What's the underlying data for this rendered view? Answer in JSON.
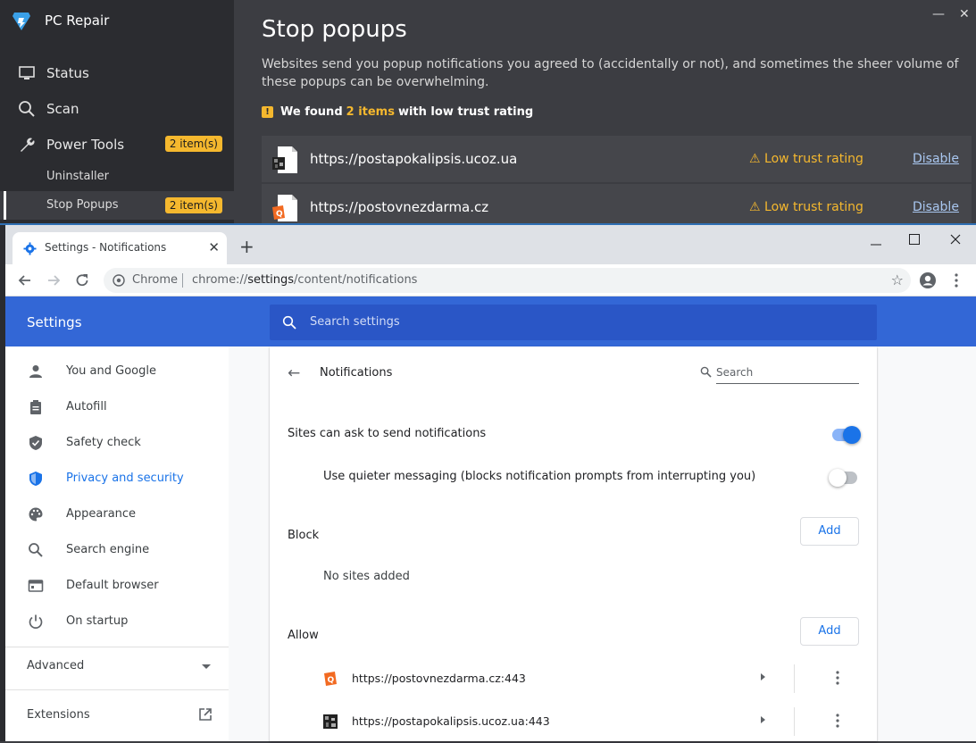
{
  "pcrepair": {
    "app_name": "PC Repair",
    "nav": [
      {
        "label": "Status",
        "icon": "monitor-icon"
      },
      {
        "label": "Scan",
        "icon": "magnifier-icon"
      },
      {
        "label": "Power Tools",
        "icon": "wrench-icon",
        "badge": "2 item(s)"
      }
    ],
    "subnav": [
      {
        "label": "Uninstaller"
      },
      {
        "label": "Stop Popups",
        "badge": "2 item(s)",
        "active": true
      }
    ],
    "page_title": "Stop popups",
    "description": "Websites send you popup notifications you agreed to (accidentally or not), and sometimes the sheer volume of these popups can be overwhelming.",
    "found_prefix": "We found",
    "found_count": "2 items",
    "found_suffix": "with low trust rating",
    "rows": [
      {
        "url": "https://postapokalipsis.ucoz.ua",
        "trust": "Low trust rating",
        "action": "Disable"
      },
      {
        "url": "https://postovnezdarma.cz",
        "trust": "Low trust rating",
        "action": "Disable"
      }
    ],
    "accent_color": "#f5b82e"
  },
  "chrome": {
    "tab_title": "Settings - Notifications",
    "tab_close": "✕",
    "new_tab": "+",
    "omnibox_label": "Chrome",
    "url_scheme": "chrome://",
    "url_host": "settings",
    "url_path": "/content/notifications"
  },
  "settings": {
    "title": "Settings",
    "search_placeholder": "Search settings",
    "menu": [
      {
        "label": "You and Google",
        "icon": "person-icon"
      },
      {
        "label": "Autofill",
        "icon": "clipboard-icon"
      },
      {
        "label": "Safety check",
        "icon": "shield-check-icon"
      },
      {
        "label": "Privacy and security",
        "icon": "shield-icon",
        "active": true
      },
      {
        "label": "Appearance",
        "icon": "palette-icon"
      },
      {
        "label": "Search engine",
        "icon": "search-icon"
      },
      {
        "label": "Default browser",
        "icon": "browser-icon"
      },
      {
        "label": "On startup",
        "icon": "power-icon"
      }
    ],
    "advanced": "Advanced",
    "extensions": "Extensions",
    "page": {
      "title": "Notifications",
      "search_placeholder": "Search",
      "sites_can_ask": "Sites can ask to send notifications",
      "sites_can_ask_on": true,
      "quieter": "Use quieter messaging (blocks notification prompts from interrupting you)",
      "quieter_on": false,
      "block_label": "Block",
      "block_add": "Add",
      "block_empty": "No sites added",
      "allow_label": "Allow",
      "allow_add": "Add",
      "allow_sites": [
        {
          "url": "https://postovnezdarma.cz:443"
        },
        {
          "url": "https://postapokalipsis.ucoz.ua:443"
        }
      ]
    },
    "accent_color": "#1a73e8",
    "header_color": "#3367d6"
  }
}
